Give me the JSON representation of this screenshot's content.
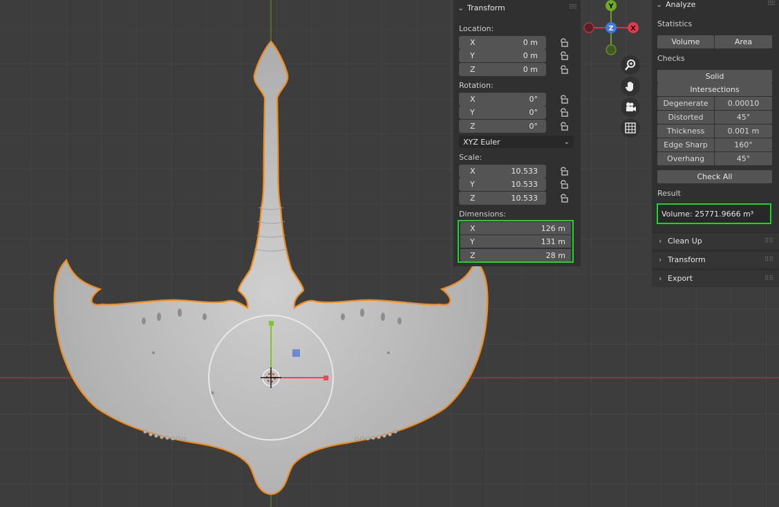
{
  "transform_panel": {
    "title": "Transform",
    "location_label": "Location:",
    "location": [
      {
        "axis": "X",
        "value": "0 m"
      },
      {
        "axis": "Y",
        "value": "0 m"
      },
      {
        "axis": "Z",
        "value": "0 m"
      }
    ],
    "rotation_label": "Rotation:",
    "rotation": [
      {
        "axis": "X",
        "value": "0°"
      },
      {
        "axis": "Y",
        "value": "0°"
      },
      {
        "axis": "Z",
        "value": "0°"
      }
    ],
    "rotation_mode": "XYZ Euler",
    "scale_label": "Scale:",
    "scale": [
      {
        "axis": "X",
        "value": "10.533"
      },
      {
        "axis": "Y",
        "value": "10.533"
      },
      {
        "axis": "Z",
        "value": "10.533"
      }
    ],
    "dimensions_label": "Dimensions:",
    "dimensions": [
      {
        "axis": "X",
        "value": "126 m"
      },
      {
        "axis": "Y",
        "value": "131 m"
      },
      {
        "axis": "Z",
        "value": "28 m"
      }
    ]
  },
  "gizmo": {
    "y_label": "Y",
    "z_label": "Z",
    "x_label": "X",
    "tools": [
      "zoom-icon",
      "pan-hand-icon",
      "camera-icon",
      "grid-icon"
    ]
  },
  "analyze_panel": {
    "title": "Analyze",
    "statistics_label": "Statistics",
    "volume_button": "Volume",
    "area_button": "Area",
    "checks_label": "Checks",
    "solid_button": "Solid",
    "intersections_button": "Intersections",
    "checks": [
      {
        "label": "Degenerate",
        "value": "0.00010"
      },
      {
        "label": "Distorted",
        "value": "45°"
      },
      {
        "label": "Thickness",
        "value": "0.001 m"
      },
      {
        "label": "Edge Sharp",
        "value": "160°"
      },
      {
        "label": "Overhang",
        "value": "45°"
      }
    ],
    "check_all_button": "Check All",
    "result_label": "Result",
    "result_value": "Volume: 25771.9666 m³",
    "subpanels": [
      "Clean Up",
      "Transform",
      "Export"
    ]
  },
  "colors": {
    "viewport_bg": "#3d3d3d",
    "grid": "#4a4a4a",
    "x_axis": "#a03a44",
    "y_axis": "#6e9a2a",
    "selection_outline": "#f28c1a",
    "highlight": "#22d22a"
  }
}
